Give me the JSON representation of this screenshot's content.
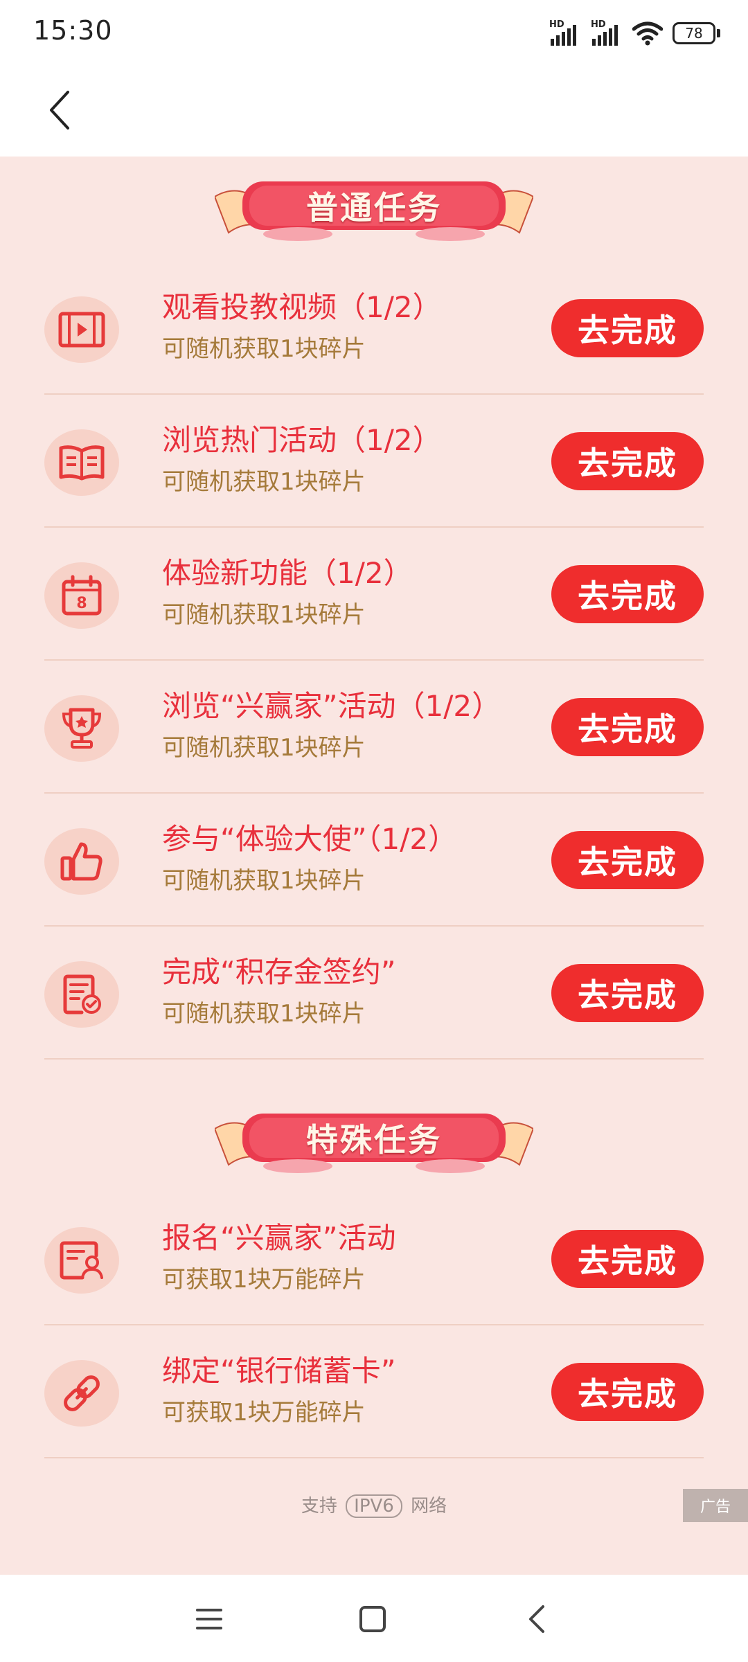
{
  "status_bar": {
    "time": "15:30",
    "signal1_label": "HD",
    "signal2_label": "HD",
    "battery": "78"
  },
  "sections": [
    {
      "title": "普通任务",
      "tasks": [
        {
          "icon": "video-icon",
          "title": "观看投教视频（1/2）",
          "subtitle": "可随机获取1块碎片",
          "button": "去完成"
        },
        {
          "icon": "book-icon",
          "title": "浏览热门活动（1/2）",
          "subtitle": "可随机获取1块碎片",
          "button": "去完成"
        },
        {
          "icon": "calendar-icon",
          "title": "体验新功能（1/2）",
          "subtitle": "可随机获取1块碎片",
          "button": "去完成"
        },
        {
          "icon": "trophy-icon",
          "title": "浏览“兴赢家”活动（1/2）",
          "subtitle": "可随机获取1块碎片",
          "button": "去完成"
        },
        {
          "icon": "thumbs-up-icon",
          "title": "参与“体验大使”（1/2）",
          "subtitle": "可随机获取1块碎片",
          "button": "去完成"
        },
        {
          "icon": "document-check-icon",
          "title": "完成“积存金签约”",
          "subtitle": "可随机获取1块碎片",
          "button": "去完成"
        }
      ]
    },
    {
      "title": "特殊任务",
      "tasks": [
        {
          "icon": "user-card-icon",
          "title": "报名“兴赢家”活动",
          "subtitle": "可获取1块万能碎片",
          "button": "去完成"
        },
        {
          "icon": "link-icon",
          "title": "绑定“银行储蓄卡”",
          "subtitle": "可获取1块万能碎片",
          "button": "去完成"
        }
      ]
    }
  ],
  "footer": {
    "support_text": "支持",
    "ipv6_badge": "IPV6",
    "network_text": "网络",
    "ad_label": "广告"
  },
  "colors": {
    "accent_red": "#ef2d2d",
    "title_red": "#e8303c",
    "subtitle_gold": "#a57a3a",
    "page_background": "#fae6e2"
  }
}
